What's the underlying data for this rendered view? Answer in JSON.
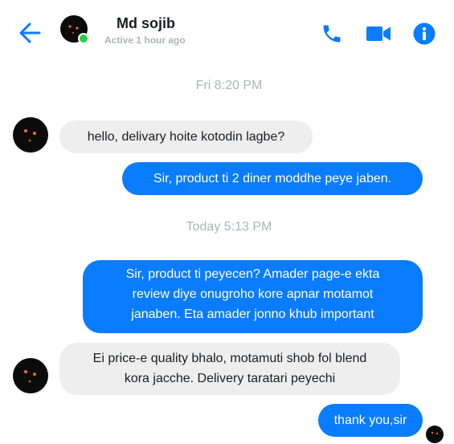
{
  "header": {
    "contact_name": "Md sojib",
    "status": "Active 1 hour ago",
    "icons": [
      "back-arrow-icon",
      "phone-icon",
      "video-camera-icon",
      "info-icon"
    ]
  },
  "colors": {
    "accent": "#0a7cff",
    "incoming_bubble": "#eeeeee",
    "online": "#31cc46"
  },
  "conversation": {
    "timestamps": [
      "Fri 8:20 PM",
      "Today 5:13 PM"
    ],
    "messages": [
      {
        "from": "contact",
        "text": "hello, delivary hoite kotodin lagbe?"
      },
      {
        "from": "me",
        "text": "Sir, product ti 2 diner moddhe peye jaben."
      },
      {
        "from": "me",
        "lines": [
          "Sir, product ti peyecen? Amader page-e ekta",
          "review diye onugroho kore apnar motamot",
          "janaben. Eta amader jonno khub important"
        ]
      },
      {
        "from": "contact",
        "lines": [
          "Ei price-e quality bhalo, motamuti shob fol blend",
          "kora jacche. Delivery taratari peyechi"
        ]
      },
      {
        "from": "me",
        "text": "thank you,sir"
      }
    ]
  }
}
